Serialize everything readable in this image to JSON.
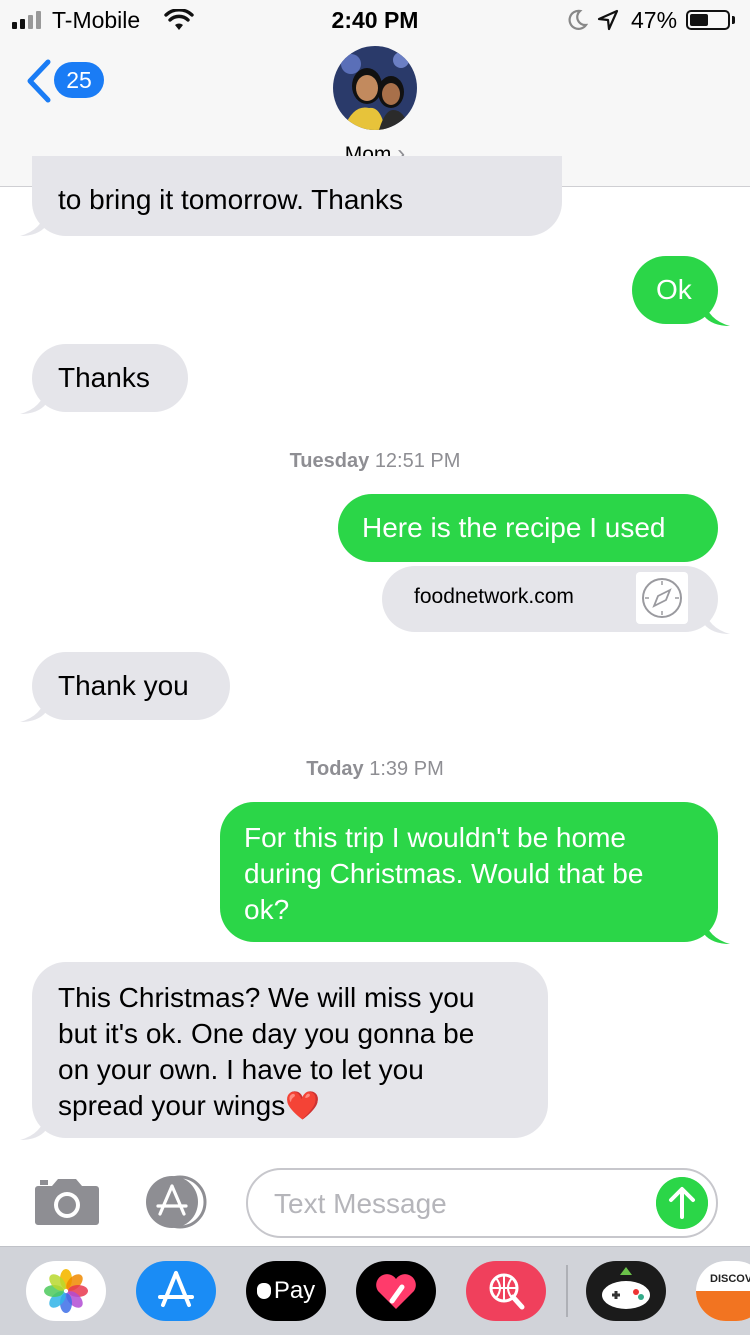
{
  "status_bar": {
    "carrier": "T-Mobile",
    "time": "2:40 PM",
    "battery_percent": "47%"
  },
  "header": {
    "back_count": "25",
    "contact_name": "Mom",
    "contact_chevron": "›"
  },
  "messages": [
    {
      "dir": "in",
      "text": "to bring it tomorrow.  Thanks"
    },
    {
      "dir": "out",
      "text": "Ok"
    },
    {
      "dir": "in",
      "text": "Thanks"
    },
    {
      "dir": "out",
      "text": "Here is the recipe I used"
    },
    {
      "dir": "out",
      "text": "foodnetwork.com",
      "kind": "link-preview",
      "icon": "safari-compass-icon"
    },
    {
      "dir": "in",
      "text": "Thank you"
    },
    {
      "dir": "out",
      "lines": [
        "For this trip I wouldn't be home",
        "during Christmas. Would that be",
        "ok?"
      ]
    },
    {
      "dir": "in",
      "lines": [
        "This Christmas?  We will miss you",
        "but it's ok. One day you gonna be",
        "on your own.  I have to let you",
        "spread your wings"
      ],
      "emoji": "❤️"
    }
  ],
  "timestamps": [
    {
      "day": "Tuesday",
      "time": "12:51 PM"
    },
    {
      "day": "Today",
      "time": "1:39 PM"
    }
  ],
  "compose": {
    "placeholder": "Text Message",
    "value": ""
  },
  "app_drawer": {
    "apps": [
      "photos-app",
      "app-store-app",
      "apple-pay-app",
      "digital-touch-app",
      "images-search-app",
      "game-app",
      "discover-app"
    ],
    "apple_pay_label": "Pay",
    "discover_label": "DISCOV"
  },
  "colors": {
    "sent_bubble": "#2bd648",
    "received_bubble": "#e5e5ea",
    "accent_blue": "#1a7cf5"
  }
}
